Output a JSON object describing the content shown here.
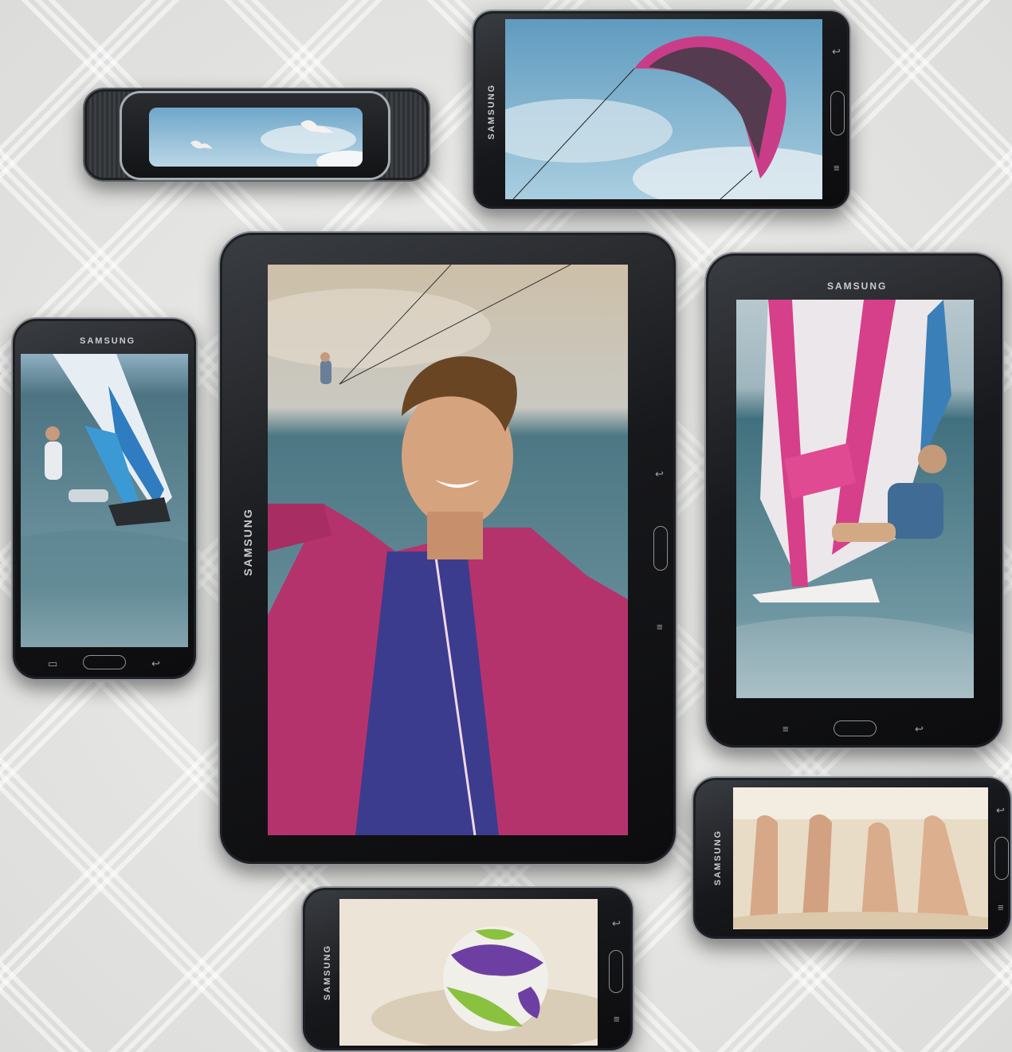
{
  "brand": {
    "name": "SAMSUNG"
  },
  "devices": [
    {
      "id": "gear",
      "kind": "wristband",
      "screen_scene": "seagulls-sky"
    },
    {
      "id": "note",
      "kind": "phone-landscape",
      "screen_scene": "kite-sky"
    },
    {
      "id": "tablet",
      "kind": "tablet-large",
      "screen_scene": "selfie-man-kitesurf"
    },
    {
      "id": "tab7",
      "kind": "tablet-small",
      "screen_scene": "windsurfer-pink-sail"
    },
    {
      "id": "s5",
      "kind": "phone-portrait",
      "screen_scene": "windsurfer-blue-sail"
    },
    {
      "id": "s4",
      "kind": "phone-landscape",
      "screen_scene": "feet-in-sand"
    },
    {
      "id": "s4b",
      "kind": "phone-landscape",
      "screen_scene": "volleyball-sand"
    }
  ],
  "colors": {
    "background": "#e4e4e2",
    "device_body": "#17181b",
    "sky": "#8ab8d2",
    "sea": "#4f7f8f",
    "jacket": "#b8326a",
    "sail_pink": "#e0478e",
    "sand": "#e9dcc6"
  }
}
